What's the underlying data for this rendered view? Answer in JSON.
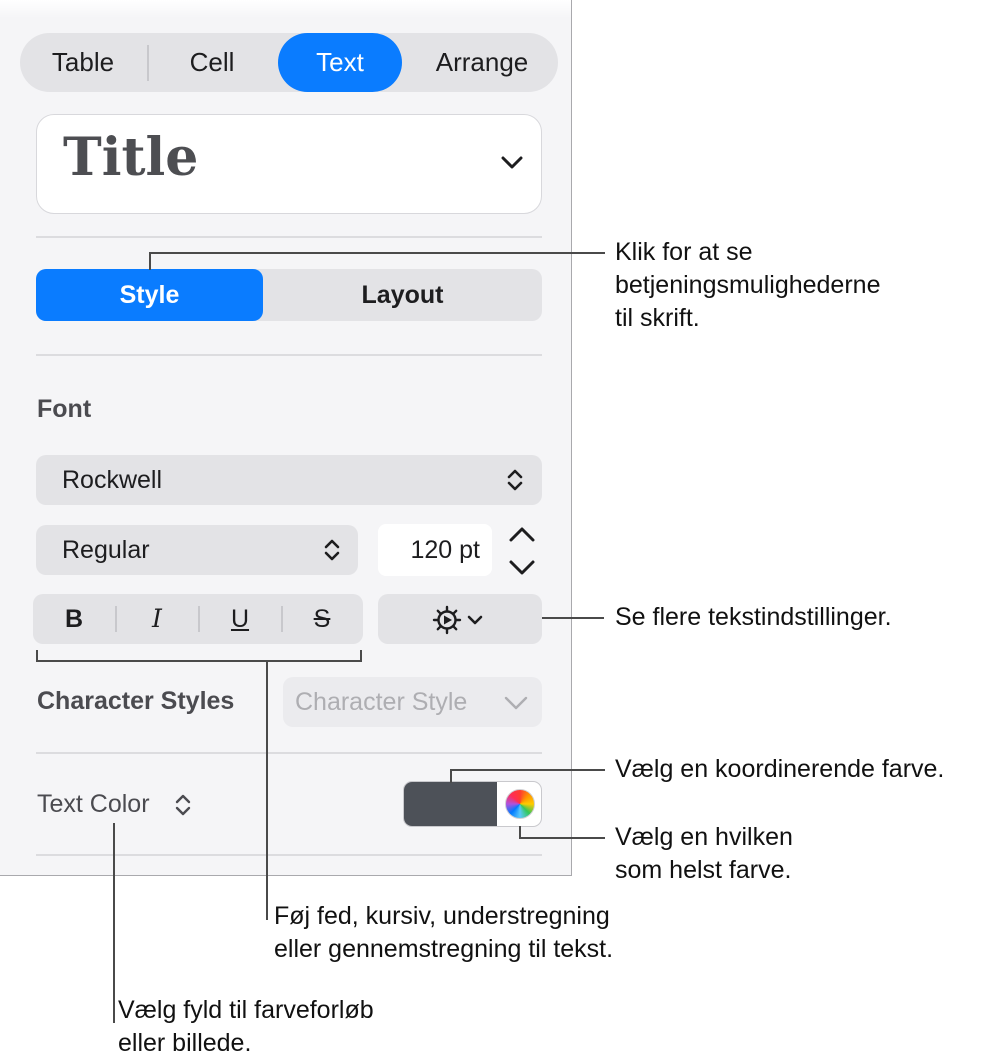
{
  "tabs": [
    {
      "label": "Table"
    },
    {
      "label": "Cell"
    },
    {
      "label": "Text"
    },
    {
      "label": "Arrange"
    }
  ],
  "paragraph_style": {
    "value": "Title"
  },
  "segments": {
    "style": "Style",
    "layout": "Layout"
  },
  "font": {
    "section_label": "Font",
    "family": "Rockwell",
    "typeface": "Regular",
    "size": "120 pt",
    "bold": "B",
    "italic": "I",
    "underline": "U",
    "strikethrough": "S"
  },
  "character_styles": {
    "label": "Character Styles",
    "placeholder": "Character Style"
  },
  "text_color": {
    "label": "Text Color",
    "swatch_color": "#4d5158"
  },
  "callouts": {
    "style_tab": [
      "Klik for at se",
      "betjeningsmulighederne",
      "til skrift."
    ],
    "more_options": [
      "Se flere tekstindstillinger."
    ],
    "coordinating_color": [
      "Vælg en koordinerende farve."
    ],
    "any_color": [
      "Vælg en hvilken",
      "som helst farve."
    ],
    "format_buttons": [
      "Føj fed, kursiv, understregning",
      "eller gennemstregning til tekst."
    ],
    "fill": [
      "Vælg fyld til farveforløb",
      "eller billede."
    ]
  },
  "colors": {
    "accent": "#0a7cff",
    "panel": "#f5f5f7",
    "control": "#e3e3e6"
  }
}
